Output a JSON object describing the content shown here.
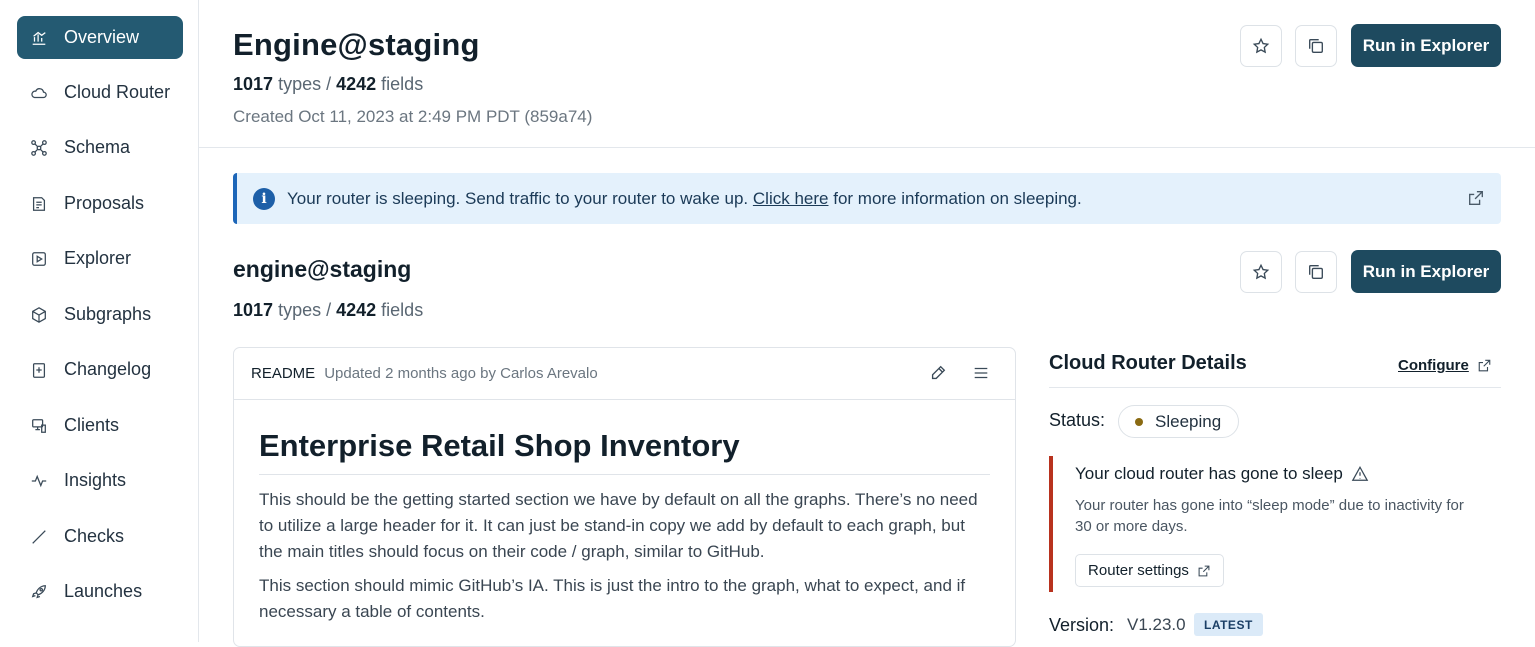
{
  "sidebar": {
    "items": [
      {
        "label": "Overview",
        "icon": "overview-icon",
        "active": true
      },
      {
        "label": "Cloud Router",
        "icon": "cloud-icon"
      },
      {
        "label": "Schema",
        "icon": "schema-icon"
      },
      {
        "label": "Proposals",
        "icon": "proposals-icon"
      },
      {
        "label": "Explorer",
        "icon": "play-icon"
      },
      {
        "label": "Subgraphs",
        "icon": "cube-icon"
      },
      {
        "label": "Changelog",
        "icon": "changelog-icon"
      },
      {
        "label": "Clients",
        "icon": "clients-icon"
      },
      {
        "label": "Insights",
        "icon": "pulse-icon"
      },
      {
        "label": "Checks",
        "icon": "check-icon"
      },
      {
        "label": "Launches",
        "icon": "rocket-icon"
      }
    ]
  },
  "header": {
    "title": "Engine@staging",
    "types_count": "1017",
    "types_label": "types /",
    "fields_count": "4242",
    "fields_label": "fields",
    "created": "Created Oct 11, 2023 at 2:49 PM PDT (859a74)",
    "run_label": "Run in Explorer"
  },
  "banner": {
    "text_before": "Your router is sleeping. Send traffic to your router to wake up.",
    "link": "Click here",
    "text_after": "for more information on sleeping."
  },
  "section": {
    "title": "engine@staging",
    "types_count": "1017",
    "types_label": "types /",
    "fields_count": "4242",
    "fields_label": "fields",
    "run_label": "Run in Explorer"
  },
  "readme": {
    "label": "README",
    "meta": "Updated 2 months ago by Carlos Arevalo",
    "title": "Enterprise Retail Shop Inventory",
    "p1": "This should be the getting started section we have by default on all the graphs. There’s no need to utilize a large header for it. It can just be stand-in copy we add by default to each graph, but the main titles should focus on their code / graph, similar to GitHub.",
    "p2": "This section should mimic GitHub’s IA. This is just the intro to the graph, what to expect, and if necessary a table of contents."
  },
  "router": {
    "title": "Cloud Router Details",
    "configure": "Configure",
    "status_label": "Status:",
    "status_value": "Sleeping",
    "status_color": "#8a6a12",
    "alert_title": "Your cloud router has gone to sleep",
    "alert_text": "Your router has gone into “sleep mode” due to inactivity for 30 or more days.",
    "alert_button": "Router settings",
    "version_label": "Version:",
    "version_value": "V1.23.0",
    "version_badge": "LATEST"
  },
  "colors": {
    "accent": "#245a72",
    "primary_button": "#1e4a5f",
    "banner_bg": "#e4f1fc",
    "alert_border": "#b8321e"
  }
}
